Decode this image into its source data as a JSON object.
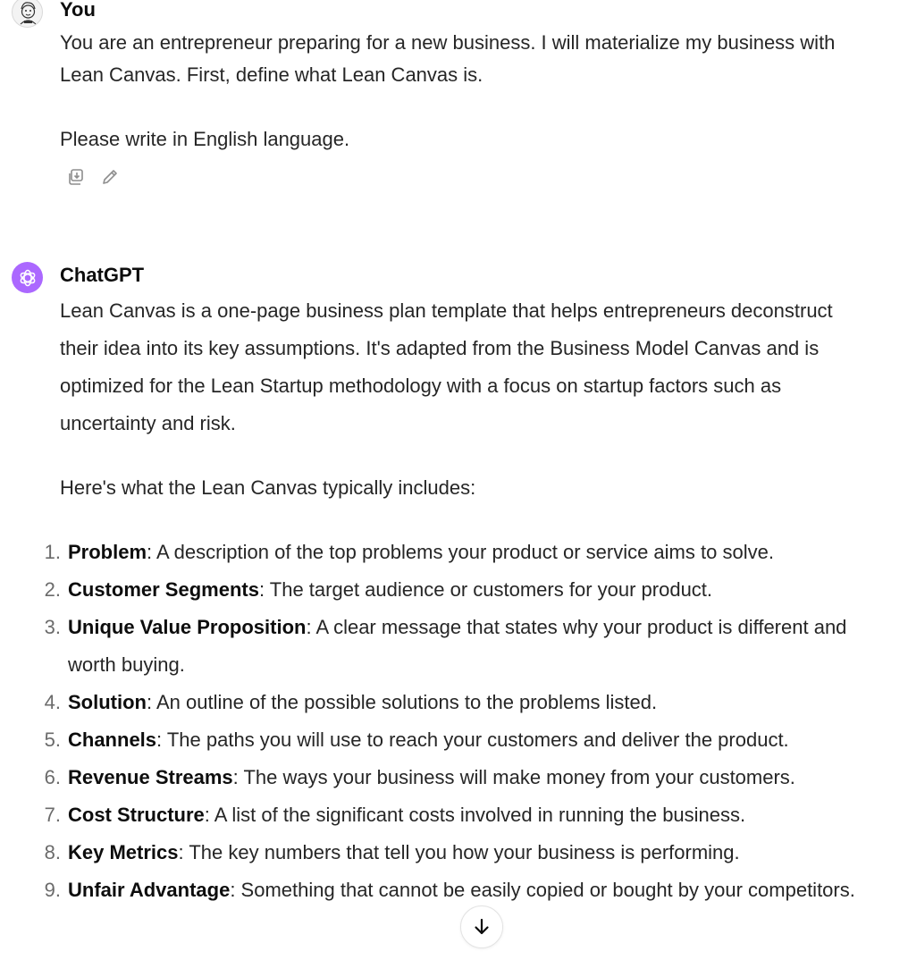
{
  "user_message": {
    "author": "You",
    "paragraphs": [
      "You are an entrepreneur preparing for a new business. I will materialize my business with Lean Canvas. First, define what Lean Canvas is.",
      "Please write in English language."
    ],
    "actions": [
      "copy-icon",
      "edit-icon"
    ]
  },
  "assistant_message": {
    "author": "ChatGPT",
    "paragraphs": [
      "Lean Canvas is a one-page business plan template that helps entrepreneurs deconstruct their idea into its key assumptions. It's adapted from the Business Model Canvas and is optimized for the Lean Startup methodology with a focus on startup factors such as uncertainty and risk.",
      "Here's what the Lean Canvas typically includes:"
    ],
    "items": [
      {
        "num": "1.",
        "term": "Problem",
        "desc": ": A description of the top problems your product or service aims to solve."
      },
      {
        "num": "2.",
        "term": "Customer Segments",
        "desc": ": The target audience or customers for your product."
      },
      {
        "num": "3.",
        "term": "Unique Value Proposition",
        "desc": ": A clear message that states why your product is different and worth buying."
      },
      {
        "num": "4.",
        "term": "Solution",
        "desc": ": An outline of the possible solutions to the problems listed."
      },
      {
        "num": "5.",
        "term": "Channels",
        "desc": ": The paths you will use to reach your customers and deliver the product."
      },
      {
        "num": "6.",
        "term": "Revenue Streams",
        "desc": ": The ways your business will make money from your customers."
      },
      {
        "num": "7.",
        "term": "Cost Structure",
        "desc": ": A list of the significant costs involved in running the business."
      },
      {
        "num": "8.",
        "term": "Key Metrics",
        "desc": ": The key numbers that tell you how your business is performing."
      },
      {
        "num": "9.",
        "term": "Unfair Advantage",
        "desc": ": Something that cannot be easily copied or bought by your competitors."
      }
    ]
  },
  "scroll_button": {
    "icon": "arrow-down-icon"
  },
  "colors": {
    "assistant_avatar": "#ab68ff",
    "body_text": "#262626",
    "list_number": "#6b6b6b"
  }
}
